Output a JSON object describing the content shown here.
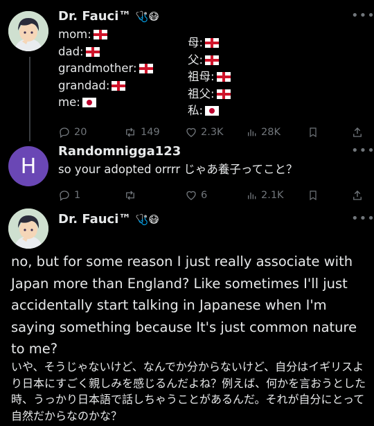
{
  "tweet1": {
    "name": "Dr. Fauci™",
    "name_emoji": "🩺😷",
    "lines_left": [
      "mom:",
      "dad:",
      "grandmother:",
      "grandad:",
      "me:"
    ],
    "flags_left": [
      "england",
      "england",
      "england",
      "england",
      "japan"
    ],
    "lines_right": [
      "母:",
      "父:",
      "祖母:",
      "祖父:",
      "私:"
    ],
    "flags_right": [
      "england",
      "england",
      "england",
      "england",
      "japan"
    ],
    "stats": {
      "replies": "20",
      "retweets": "149",
      "likes": "2.3K",
      "views": "28K"
    }
  },
  "tweet2": {
    "avatar_letter": "H",
    "name": "Randomnigga123",
    "text": "so your adopted orrrr じゃあ養子ってこと？",
    "stats": {
      "replies": "1",
      "retweets": "",
      "likes": "6",
      "views": "2.1K"
    }
  },
  "tweet3": {
    "name": "Dr. Fauci™",
    "name_emoji": "🩺😷",
    "text_en": "no, but for some reason I just really associate with Japan more than England? Like sometimes I'll just accidentally start talking in Japanese when I'm saying something because It's just common nature to me?",
    "text_jp": "いや、そうじゃないけど、なんでか分からないけど、自分はイギリスより日本にすごく親しみを感じるんだよね？例えば、何かを言おうとした時、うっかり日本語で話しちゃうことがあるんだ。それが自分にとって自然だからなのかな？"
  },
  "colors": {
    "background": "#000000",
    "text": "#e7e9ea",
    "muted": "#71767b",
    "avatar_h": "#6a47b5"
  }
}
